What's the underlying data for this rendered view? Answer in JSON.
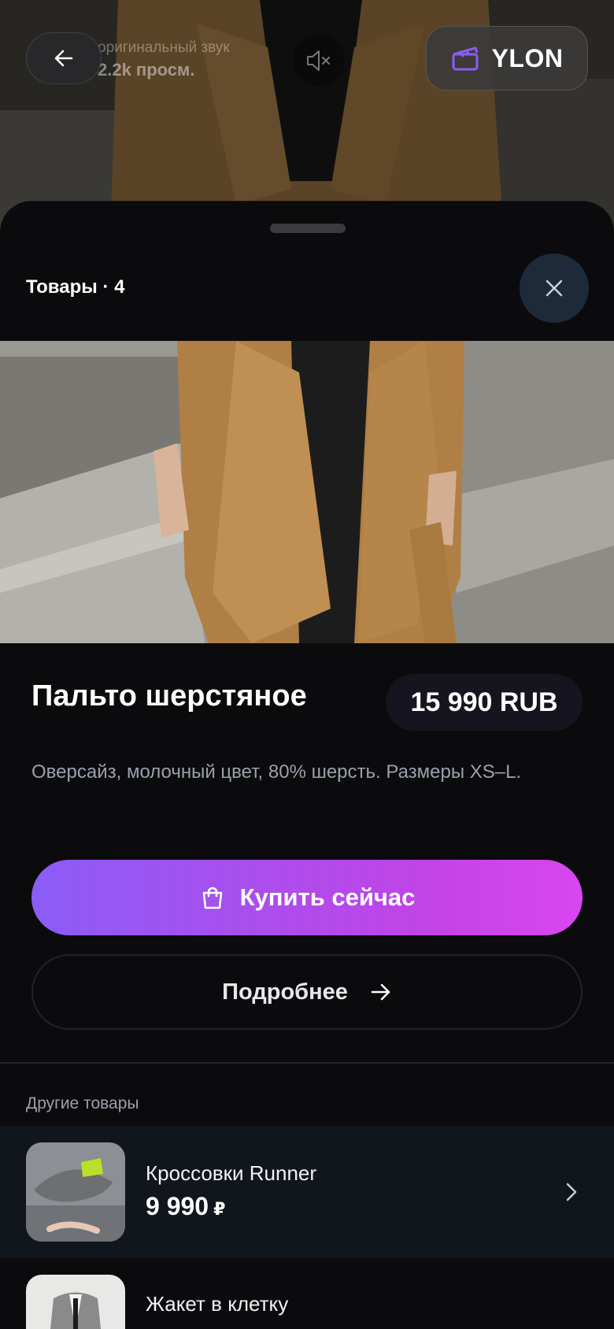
{
  "top_bar": {
    "sound_label": "оригинальный звук",
    "views_label": "2.2k просм.",
    "brand_name": "YLON"
  },
  "sheet": {
    "title": "Товары · 4"
  },
  "product": {
    "name": "Пальто шерстяное",
    "price": "15 990 RUB",
    "description": "Оверсайз, молочный цвет, 80% шерсть. Размеры XS–L.",
    "buy_label": "Купить сейчас",
    "details_label": "Подробнее"
  },
  "other": {
    "section_label": "Другие товары",
    "items": [
      {
        "name": "Кроссовки Runner",
        "price": "9 990",
        "currency": "₽"
      },
      {
        "name": "Жакет в клетку"
      }
    ]
  },
  "colors": {
    "accent_start": "#8b5cf6",
    "accent_end": "#d946ef",
    "brand_icon": "#8b5cf6"
  }
}
